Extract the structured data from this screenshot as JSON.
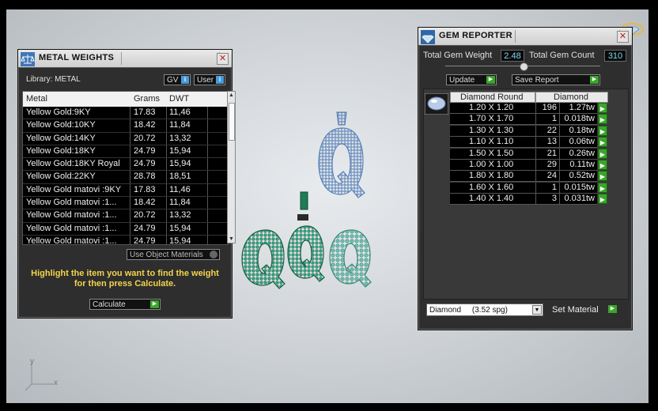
{
  "metal_weights": {
    "title": "METAL WEIGHTS",
    "library_label": "Library: METAL",
    "gv_label": "GV",
    "user_label": "User",
    "columns": [
      "Metal",
      "Grams",
      "DWT"
    ],
    "rows": [
      {
        "metal": "Yellow Gold:9KY",
        "grams": "17.83",
        "dwt": "11,46"
      },
      {
        "metal": "Yellow Gold:10KY",
        "grams": "18.42",
        "dwt": "11,84"
      },
      {
        "metal": "Yellow Gold:14KY",
        "grams": "20.72",
        "dwt": "13,32"
      },
      {
        "metal": "Yellow Gold:18KY",
        "grams": "24.79",
        "dwt": "15,94"
      },
      {
        "metal": "Yellow Gold:18KY Royal",
        "grams": "24.79",
        "dwt": "15,94"
      },
      {
        "metal": "Yellow Gold:22KY",
        "grams": "28.78",
        "dwt": "18,51"
      },
      {
        "metal": "Yellow Gold matovi :9KY",
        "grams": "17.83",
        "dwt": "11,46"
      },
      {
        "metal": "Yellow Gold matovi :1...",
        "grams": "18.42",
        "dwt": "11,84"
      },
      {
        "metal": "Yellow Gold matovi :1...",
        "grams": "20.72",
        "dwt": "13,32"
      },
      {
        "metal": "Yellow Gold matovi :1...",
        "grams": "24.79",
        "dwt": "15,94"
      },
      {
        "metal": "Yellow Gold matovi :1...",
        "grams": "24.79",
        "dwt": "15,94"
      }
    ],
    "use_object_materials": "Use Object Materials",
    "instruction": "Highlight the item you want to find the weight for then press Calculate.",
    "calculate_label": "Calculate"
  },
  "gem_reporter": {
    "title": "GEM REPORTER",
    "total_weight_label": "Total Gem Weight",
    "total_weight_value": "2.48",
    "total_count_label": "Total Gem Count",
    "total_count_value": "310",
    "update_label": "Update",
    "save_report_label": "Save Report",
    "col_shape": "Diamond Round",
    "col_material": "Diamond",
    "rows": [
      {
        "size": "1.20 X 1.20",
        "count": "196",
        "weight": "1.27tw"
      },
      {
        "size": "1.70 X 1.70",
        "count": "1",
        "weight": "0.018tw"
      },
      {
        "size": "1.30 X 1.30",
        "count": "22",
        "weight": "0.18tw"
      },
      {
        "size": "1.10 X 1.10",
        "count": "13",
        "weight": "0.06tw"
      },
      {
        "size": "1.50 X 1.50",
        "count": "21",
        "weight": "0.26tw"
      },
      {
        "size": "1.00 X 1.00",
        "count": "29",
        "weight": "0.11tw"
      },
      {
        "size": "1.80 X 1.80",
        "count": "24",
        "weight": "0.52tw"
      },
      {
        "size": "1.60 X 1.60",
        "count": "1",
        "weight": "0.015tw"
      },
      {
        "size": "1.40 X 1.40",
        "count": "3",
        "weight": "0.031tw"
      }
    ],
    "material_select": "Diamond     (3.52 spg)",
    "set_material_label": "Set Material"
  },
  "axis": {
    "x": "x",
    "y": "y"
  },
  "colors": {
    "accent_green": "#3aa52a",
    "value_blue": "#7bd6f0",
    "hint_yellow": "#f3d44b"
  }
}
